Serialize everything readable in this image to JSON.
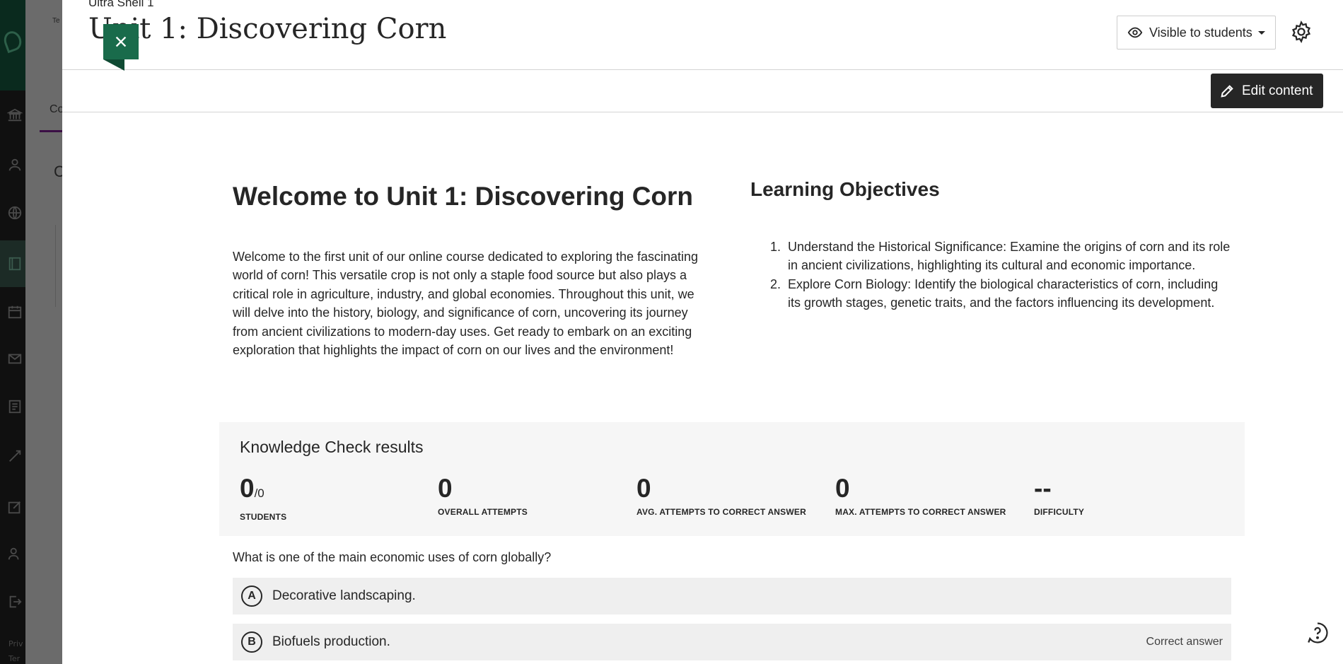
{
  "background": {
    "tab_partial": "Co",
    "heading_partial": "C",
    "top_partial": "Te",
    "footer_lines": [
      "Priv",
      "Ter"
    ]
  },
  "header": {
    "course_name": "Ultra Shell 1",
    "title": "Unit 1: Discovering Corn",
    "visibility_label": "Visible to students"
  },
  "toolbar": {
    "edit_label": "Edit content"
  },
  "welcome": {
    "title": "Welcome to Unit 1: Discovering Corn",
    "text": "Welcome to the first unit of our online course dedicated to exploring the fascinating world of corn! This versatile crop is not only a staple food source but also plays a critical role in agriculture, industry, and global economies. Throughout this unit, we will delve into the history, biology, and significance of corn, uncovering its journey from ancient civilizations to modern-day uses. Get ready to embark on an exciting exploration that highlights the impact of corn on our lives and the environment!"
  },
  "objectives": {
    "title": "Learning Objectives",
    "items": [
      {
        "num": "1.",
        "text": "Understand the Historical Significance: Examine the origins of corn and its role in ancient civilizations, highlighting its cultural and economic importance."
      },
      {
        "num": "2.",
        "text": "Explore Corn Biology: Identify the biological characteristics of corn, including its growth stages, genetic traits, and the factors influencing its development."
      }
    ]
  },
  "knowledge_check": {
    "title": "Knowledge Check results",
    "stats": [
      {
        "value": "0",
        "suffix": "/0",
        "label": "STUDENTS"
      },
      {
        "value": "0",
        "suffix": "",
        "label": "OVERALL ATTEMPTS"
      },
      {
        "value": "0",
        "suffix": "",
        "label": "AVG. ATTEMPTS TO CORRECT ANSWER"
      },
      {
        "value": "0",
        "suffix": "",
        "label": "MAX. ATTEMPTS TO CORRECT ANSWER"
      },
      {
        "value": "--",
        "suffix": "",
        "label": "DIFFICULTY"
      }
    ],
    "question": "What is one of the main economic uses of corn globally?",
    "answers": [
      {
        "letter": "A",
        "text": "Decorative landscaping.",
        "tag": ""
      },
      {
        "letter": "B",
        "text": "Biofuels production.",
        "tag": "Correct answer"
      }
    ]
  },
  "colors": {
    "close_button": "#196b4b",
    "edit_button": "#262626",
    "tab_underline": "#3b0f45"
  },
  "icons": {
    "close": "close-icon",
    "visibility": "eye-icon",
    "settings": "gear-icon",
    "edit": "pencil-icon",
    "help": "help-icon"
  }
}
